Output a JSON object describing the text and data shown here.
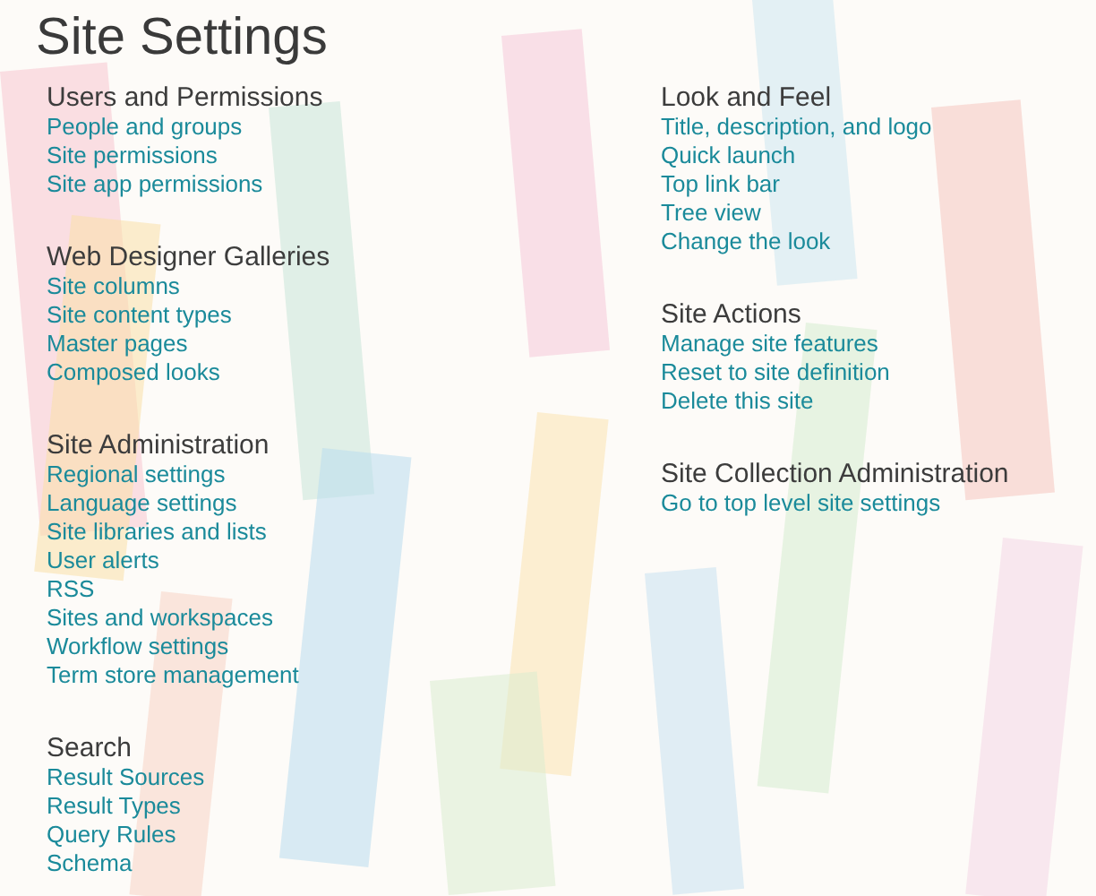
{
  "page_title": "Site Settings",
  "columns": [
    {
      "sections": [
        {
          "heading": "Users and Permissions",
          "links": [
            "People and groups",
            "Site permissions",
            "Site app permissions"
          ]
        },
        {
          "heading": "Web Designer Galleries",
          "links": [
            "Site columns",
            "Site content types",
            "Master pages",
            "Composed looks"
          ]
        },
        {
          "heading": "Site Administration",
          "links": [
            "Regional settings",
            "Language settings",
            "Site libraries and lists",
            "User alerts",
            "RSS",
            "Sites and workspaces",
            "Workflow settings",
            "Term store management"
          ]
        },
        {
          "heading": "Search",
          "links": [
            "Result Sources",
            "Result Types",
            "Query Rules",
            "Schema"
          ]
        }
      ]
    },
    {
      "sections": [
        {
          "heading": "Look and Feel",
          "links": [
            "Title, description, and logo",
            "Quick launch",
            "Top link bar",
            "Tree view",
            "Change the look"
          ]
        },
        {
          "heading": "Site Actions",
          "links": [
            "Manage site features",
            "Reset to site definition",
            "Delete this site"
          ]
        },
        {
          "heading": "Site Collection Administration",
          "links": [
            "Go to top level site settings"
          ]
        }
      ]
    }
  ]
}
